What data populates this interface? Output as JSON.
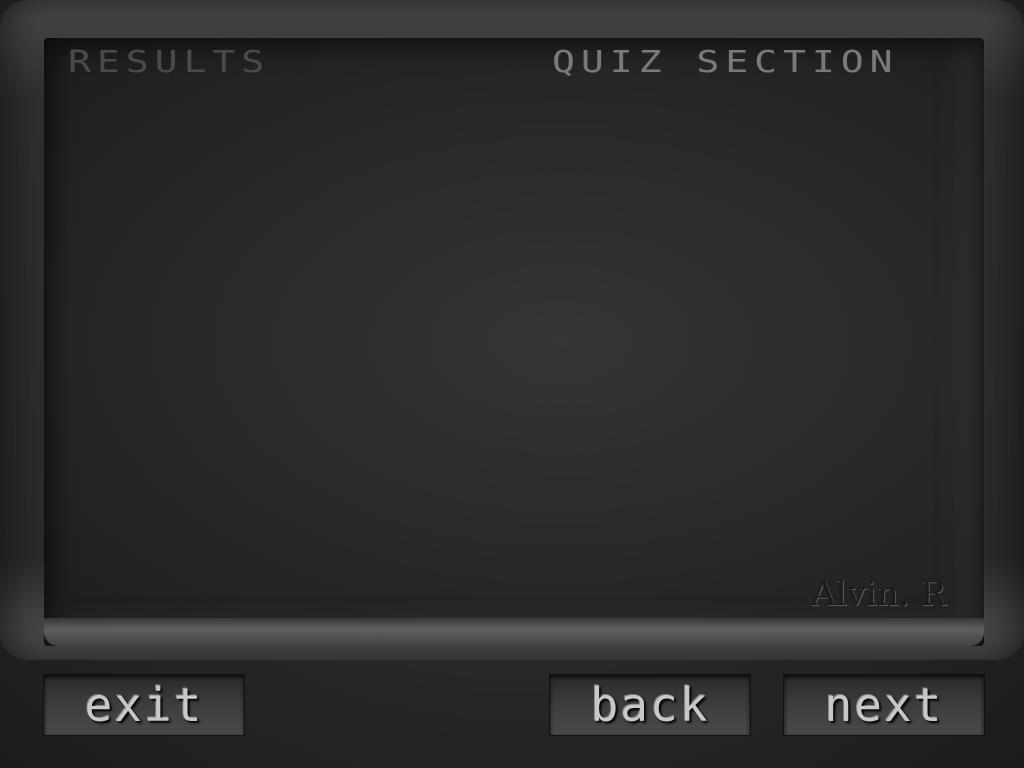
{
  "header": {
    "section_label": "RESULTS",
    "quiz_label": "QUIZ SECTION"
  },
  "signature": "Alvin. R",
  "nav": {
    "exit_label": "exit",
    "back_label": "back",
    "next_label": "next"
  }
}
